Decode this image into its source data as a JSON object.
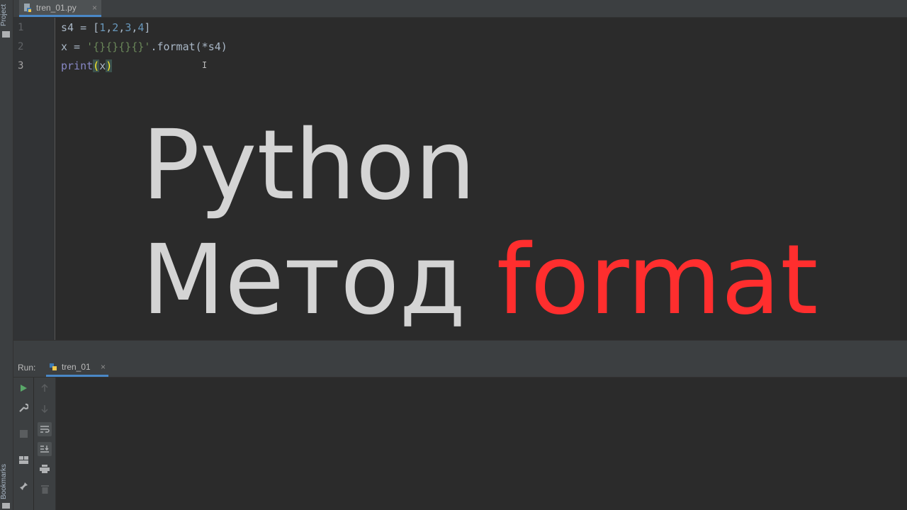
{
  "tool_strip": {
    "project_label": "Project",
    "bookmarks_label": "Bookmarks"
  },
  "editor_tab": {
    "filename": "tren_01.py",
    "close_symbol": "×"
  },
  "gutter": {
    "line_numbers": [
      "1",
      "2",
      "3"
    ]
  },
  "code": {
    "line1": {
      "prefix": "s4 = [",
      "n1": "1",
      "c1": ",",
      "n2": "2",
      "c2": ",",
      "n3": "3",
      "c3": ",",
      "n4": "4",
      "suffix": "]"
    },
    "line2": {
      "prefix": "x = ",
      "string": "'{}{}{}{}'",
      "suffix": ".format(*s4)"
    },
    "line3": {
      "func": "print",
      "open": "(",
      "arg": "x",
      "close": ")"
    }
  },
  "overlay": {
    "line1": "Python",
    "line2_main": "Метод",
    "line2_accent": "format"
  },
  "run_panel": {
    "label": "Run:",
    "tab_name": "tren_01",
    "close_symbol": "×"
  },
  "colors": {
    "accent": "#ff2e2e",
    "selection_underline": "#4a88c7",
    "background": "#2b2b2b"
  }
}
